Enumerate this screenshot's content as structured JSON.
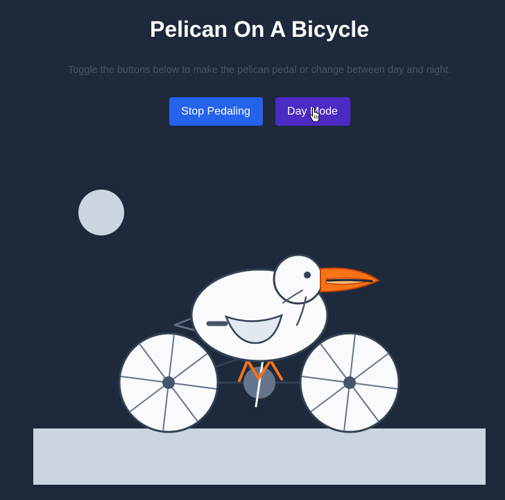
{
  "header": {
    "title": "Pelican On A Bicycle",
    "subtitle": "Toggle the buttons below to make the pelican pedal or change between day and night."
  },
  "controls": {
    "pedal_label": "Stop Pedaling",
    "mode_label": "Day Mode"
  },
  "scene": {
    "mode": "night",
    "pedaling": true
  },
  "colors": {
    "background": "#1e293b",
    "ground": "#cbd5e1",
    "moon": "#cbd5e1",
    "pedal_button": "#2563eb",
    "mode_button": "#4c2ac4",
    "beak": "#f97316",
    "pelican_body": "#f8fafc",
    "outline": "#334155"
  }
}
